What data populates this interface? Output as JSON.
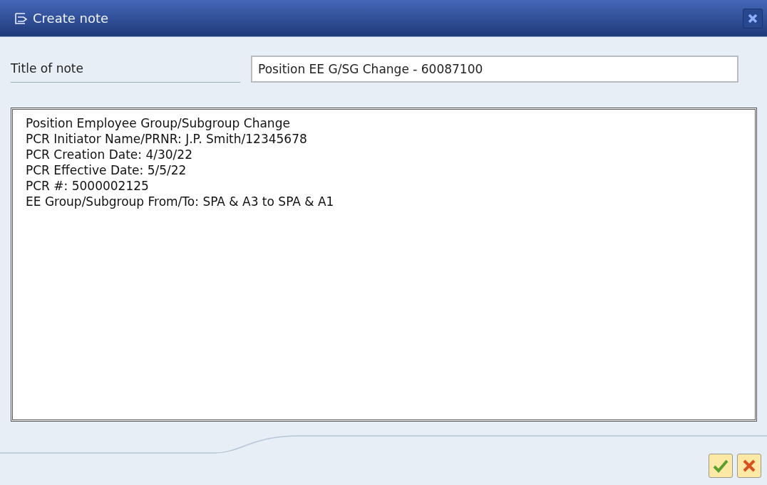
{
  "window": {
    "title": "Create note"
  },
  "title_field": {
    "label": "Title of note",
    "value": "Position EE G/SG Change - 60087100"
  },
  "note_text": {
    "lines": [
      "Position Employee Group/Subgroup Change",
      "PCR Initiator Name/PRNR: J.P. Smith/12345678",
      "PCR Creation Date: 4/30/22",
      "PCR Effective Date: 5/5/22",
      "PCR #: 5000002125",
      "EE Group/Subgroup From/To: SPA & A3 to SPA & A1"
    ]
  }
}
